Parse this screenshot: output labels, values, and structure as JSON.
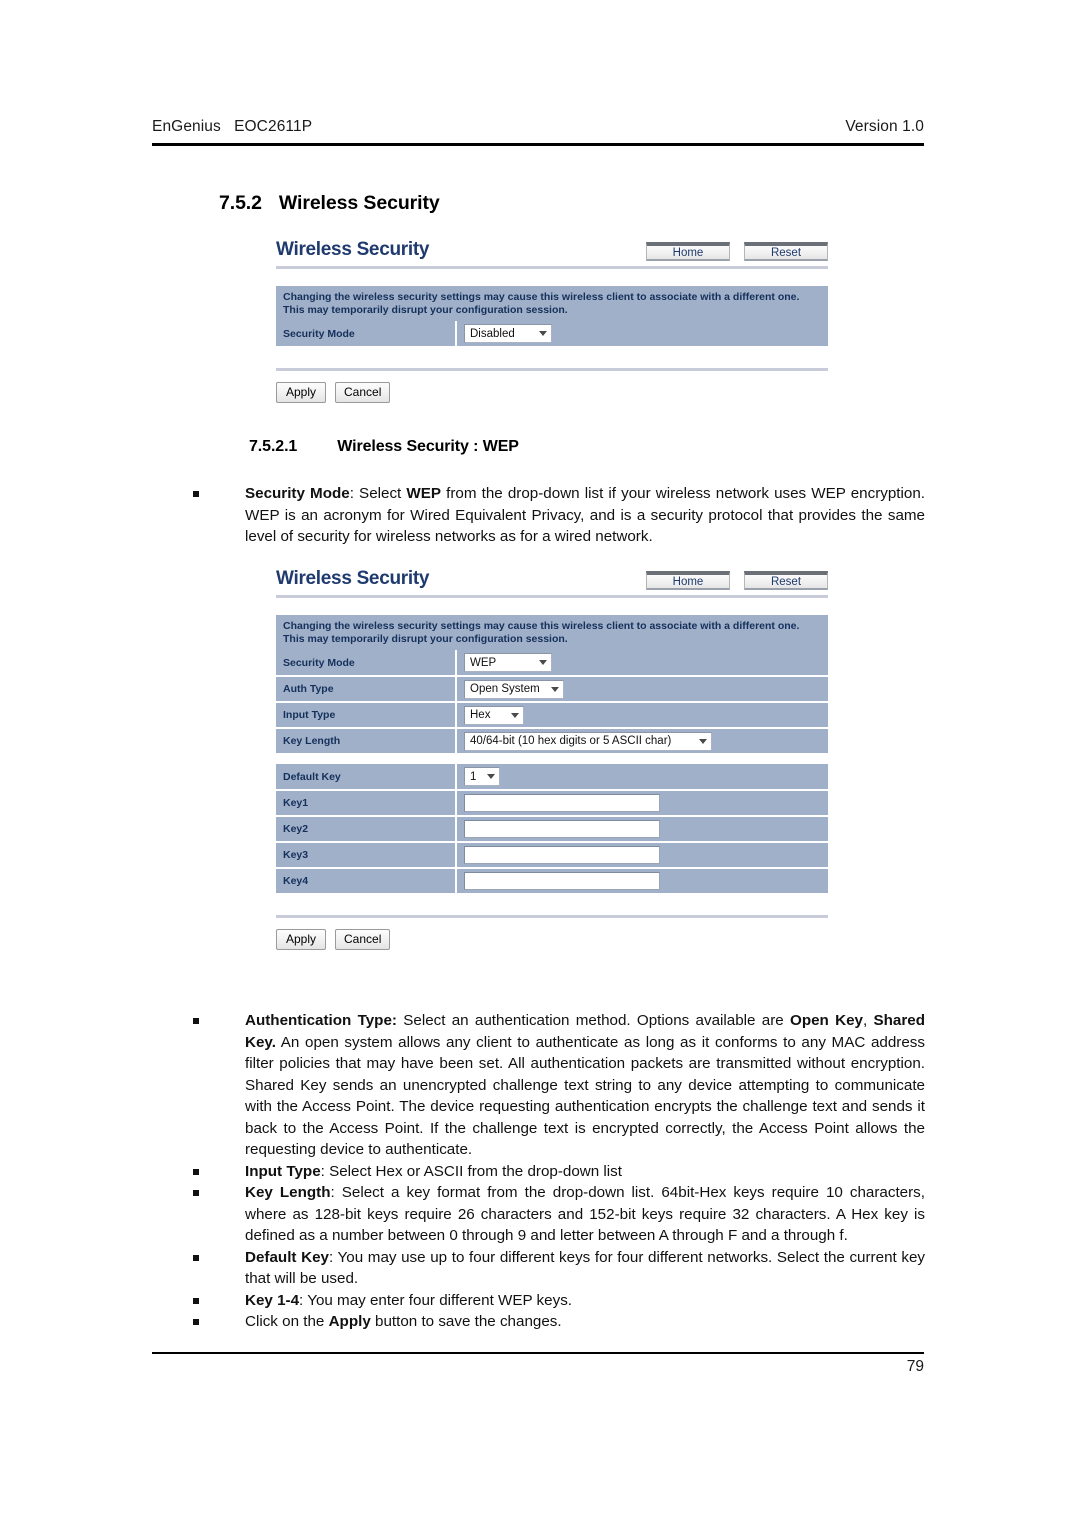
{
  "doc": {
    "header_left": "EnGenius   EOC2611P",
    "header_right": "Version 1.0",
    "page_number": "79"
  },
  "headings": {
    "h2_num": "7.5.2",
    "h2_text": "Wireless Security",
    "h3_num": "7.5.2.1",
    "h3_text": "Wireless Security : WEP"
  },
  "panel_disabled": {
    "title": "Wireless Security",
    "home_label": "Home",
    "reset_label": "Reset",
    "notice_line1": "Changing the wireless security settings may cause this wireless client to associate with a different one.",
    "notice_line2": "This may temporarily disrupt your configuration session.",
    "rows": [
      {
        "label": "Security Mode",
        "value": "Disabled"
      }
    ],
    "apply_label": "Apply",
    "cancel_label": "Cancel"
  },
  "panel_wep": {
    "title": "Wireless Security",
    "home_label": "Home",
    "reset_label": "Reset",
    "notice_line1": "Changing the wireless security settings may cause this wireless client to associate with a different one.",
    "notice_line2": "This may temporarily disrupt your configuration session.",
    "rows": [
      {
        "label": "Security Mode",
        "value": "WEP"
      },
      {
        "label": "Auth Type",
        "value": "Open System"
      },
      {
        "label": "Input Type",
        "value": "Hex"
      },
      {
        "label": "Key Length",
        "value": "40/64-bit (10 hex digits or 5 ASCII char)"
      }
    ],
    "default_key": {
      "label": "Default Key",
      "value": "1"
    },
    "keys": [
      {
        "label": "Key1",
        "value": ""
      },
      {
        "label": "Key2",
        "value": ""
      },
      {
        "label": "Key3",
        "value": ""
      },
      {
        "label": "Key4",
        "value": ""
      }
    ],
    "apply_label": "Apply",
    "cancel_label": "Cancel"
  },
  "body": {
    "bullet_security_mode_html": "<b>Security Mode</b>: Select <b>WEP</b> from the drop-down list if your wireless network uses WEP encryption. WEP is an acronym for Wired Equivalent Privacy, and is a security protocol that provides the same level of security for wireless networks as for a wired network.",
    "bullet_auth_type_html": "<b>Authentication Type:</b> Select an authentication method. Options available are <b>Open Key</b>, <b>Shared Key.</b> An open system allows any client to authenticate as long as it conforms to any MAC address filter policies that may have been set. All authentication packets are transmitted without encryption. Shared Key sends an unencrypted challenge text string to any device attempting to communicate with the Access Point. The device requesting authentication encrypts the challenge text and sends it back to the Access Point. If the challenge text is encrypted correctly, the Access Point allows the requesting device to authenticate.",
    "bullet_input_type_html": "<b>Input Type</b>: Select Hex or ASCII from the drop-down list",
    "bullet_key_length_html": "<b>Key Length</b>: Select a key format from the drop-down list. 64bit-Hex keys require 10 characters, where as 128-bit keys require 26 characters and 152-bit keys require 32 characters. A Hex key is defined as a number between 0 through 9 and letter between A through F and a through f.",
    "bullet_default_key_html": "<b>Default Key</b>: You may use up to four different keys for four different networks. Select the current key that will be used.",
    "bullet_key_1_4_html": "<b>Key 1-4</b>: You may enter four different WEP keys.",
    "bullet_apply_html": "Click on the <b>Apply</b> button to save the changes."
  },
  "colors": {
    "panel_title": "#1f3a6e",
    "notice_bg": "#9fb0c8",
    "notice_text": "#16305c",
    "rule": "#c8cbd8"
  }
}
